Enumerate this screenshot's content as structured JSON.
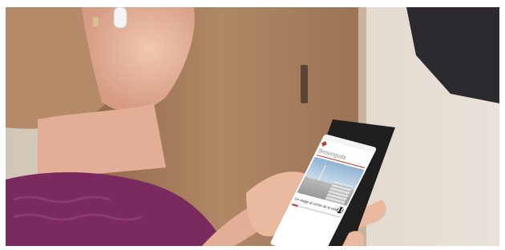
{
  "photo": {
    "subject": "person-holding-smartphone-with-earbud",
    "colors": {
      "door": "#a0785a",
      "wall": "#d8cfc4",
      "sweater": "#7a2a5e",
      "skin": "#e8b8a0",
      "hair": "#b88a66",
      "phone_frame": "#1f1f1f",
      "accent": "#c0392b"
    }
  },
  "phone_screen": {
    "status_text": "",
    "brand_text": "",
    "title": "Benvinguda",
    "episode_title": "Un viatge al centre de la vida",
    "player_state_icon": "pause-icon",
    "progress": 0.12
  }
}
